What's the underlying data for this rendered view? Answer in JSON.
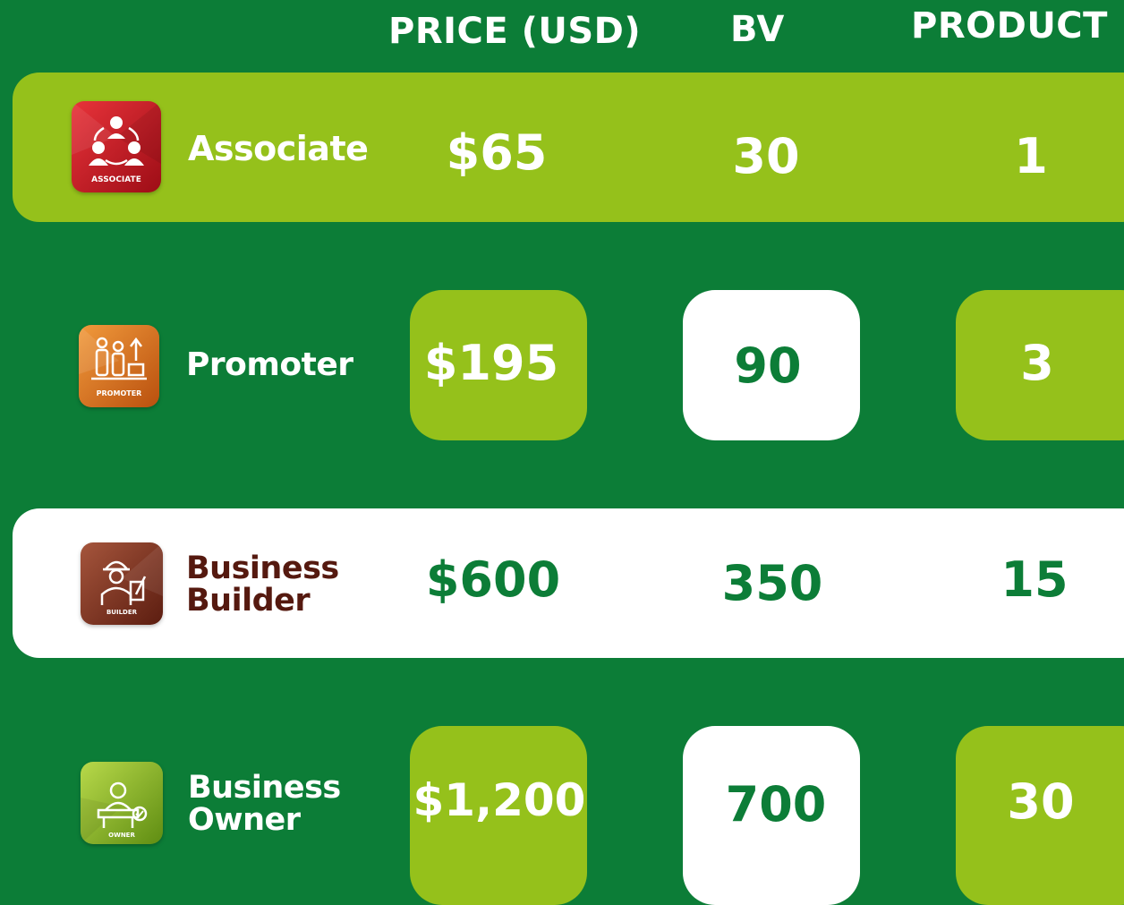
{
  "headers": {
    "price": "PRICE (USD)",
    "bv": "BV",
    "product": "PRODUCT"
  },
  "colors": {
    "background": "#0c7d37",
    "lime": "#95c11b",
    "white": "#ffffff",
    "green_text": "#0c7d37",
    "brown_text": "#55190f"
  },
  "tiers": [
    {
      "name": "Associate",
      "badge_label": "ASSOCIATE",
      "badge_icon": "team-icon",
      "price": "$65",
      "bv": "30",
      "product": "1"
    },
    {
      "name": "Promoter",
      "badge_label": "PROMOTER",
      "badge_icon": "growth-icon",
      "price": "$195",
      "bv": "90",
      "product": "3"
    },
    {
      "name_line1": "Business",
      "name_line2": "Builder",
      "badge_label": "BUILDER",
      "badge_icon": "builder-icon",
      "price": "$600",
      "bv": "350",
      "product": "15"
    },
    {
      "name_line1": "Business",
      "name_line2": "Owner",
      "badge_label": "OWNER",
      "badge_icon": "owner-icon",
      "price": "$1,200",
      "bv": "700",
      "product": "30"
    }
  ]
}
